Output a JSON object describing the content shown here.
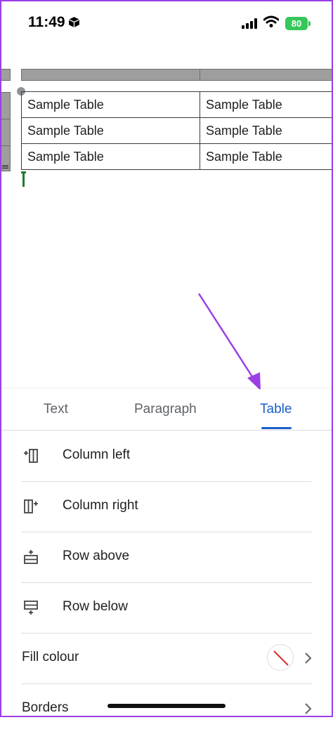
{
  "status_bar": {
    "time": "11:49",
    "battery": "80"
  },
  "document": {
    "table": {
      "rows": [
        [
          "Sample Table",
          "Sample Table"
        ],
        [
          "Sample Table",
          "Sample Table"
        ],
        [
          "Sample Table",
          "Sample Table"
        ]
      ]
    }
  },
  "sheet": {
    "tabs": [
      {
        "label": "Text"
      },
      {
        "label": "Paragraph"
      },
      {
        "label": "Table",
        "active": true
      }
    ],
    "items": [
      {
        "label": "Column left",
        "icon": "column-left-icon"
      },
      {
        "label": "Column right",
        "icon": "column-right-icon"
      },
      {
        "label": "Row above",
        "icon": "row-above-icon"
      },
      {
        "label": "Row below",
        "icon": "row-below-icon"
      },
      {
        "label": "Fill colour",
        "icon": "no-fill-swatch"
      },
      {
        "label": "Borders",
        "icon": "chevron-right-icon"
      }
    ]
  },
  "colors": {
    "accent": "#1a5fc9",
    "annotation_arrow": "#9b3fe6",
    "cursor": "#1e7a33"
  }
}
